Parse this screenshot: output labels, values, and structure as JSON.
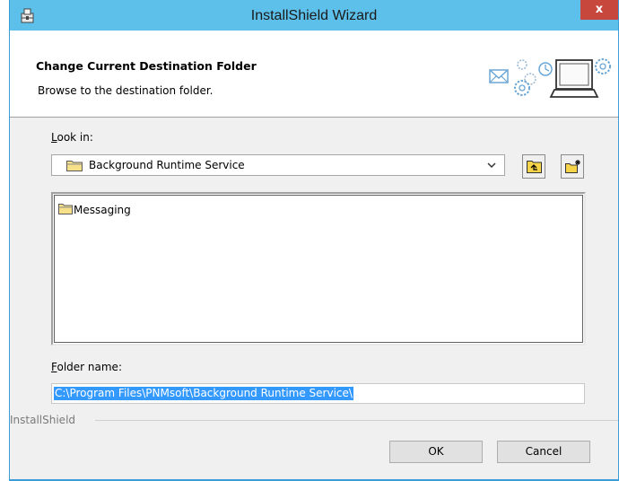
{
  "window": {
    "title": "InstallShield Wizard",
    "close_label": "x"
  },
  "header": {
    "title": "Change Current Destination Folder",
    "subtitle": "Browse to the destination folder."
  },
  "look_in": {
    "label_mnemonic": "L",
    "label_rest": "ook in:",
    "selected": "Background Runtime Service"
  },
  "folder_list": {
    "items": [
      {
        "label": "Messaging"
      }
    ]
  },
  "folder_name": {
    "label_mnemonic": "F",
    "label_rest": "older name:",
    "value": "C:\\Program Files\\PNMsoft\\Background Runtime Service\\"
  },
  "footer": {
    "group_label": "InstallShield"
  },
  "buttons": {
    "ok": "OK",
    "cancel": "Cancel"
  },
  "icons": {
    "app": "installer-icon",
    "header_art": "computer-gears-envelope-icon",
    "combo_folder": "folder-icon",
    "combo_arrow": "chevron-down-icon",
    "up_folder": "up-one-level-icon",
    "new_folder": "new-folder-icon"
  }
}
